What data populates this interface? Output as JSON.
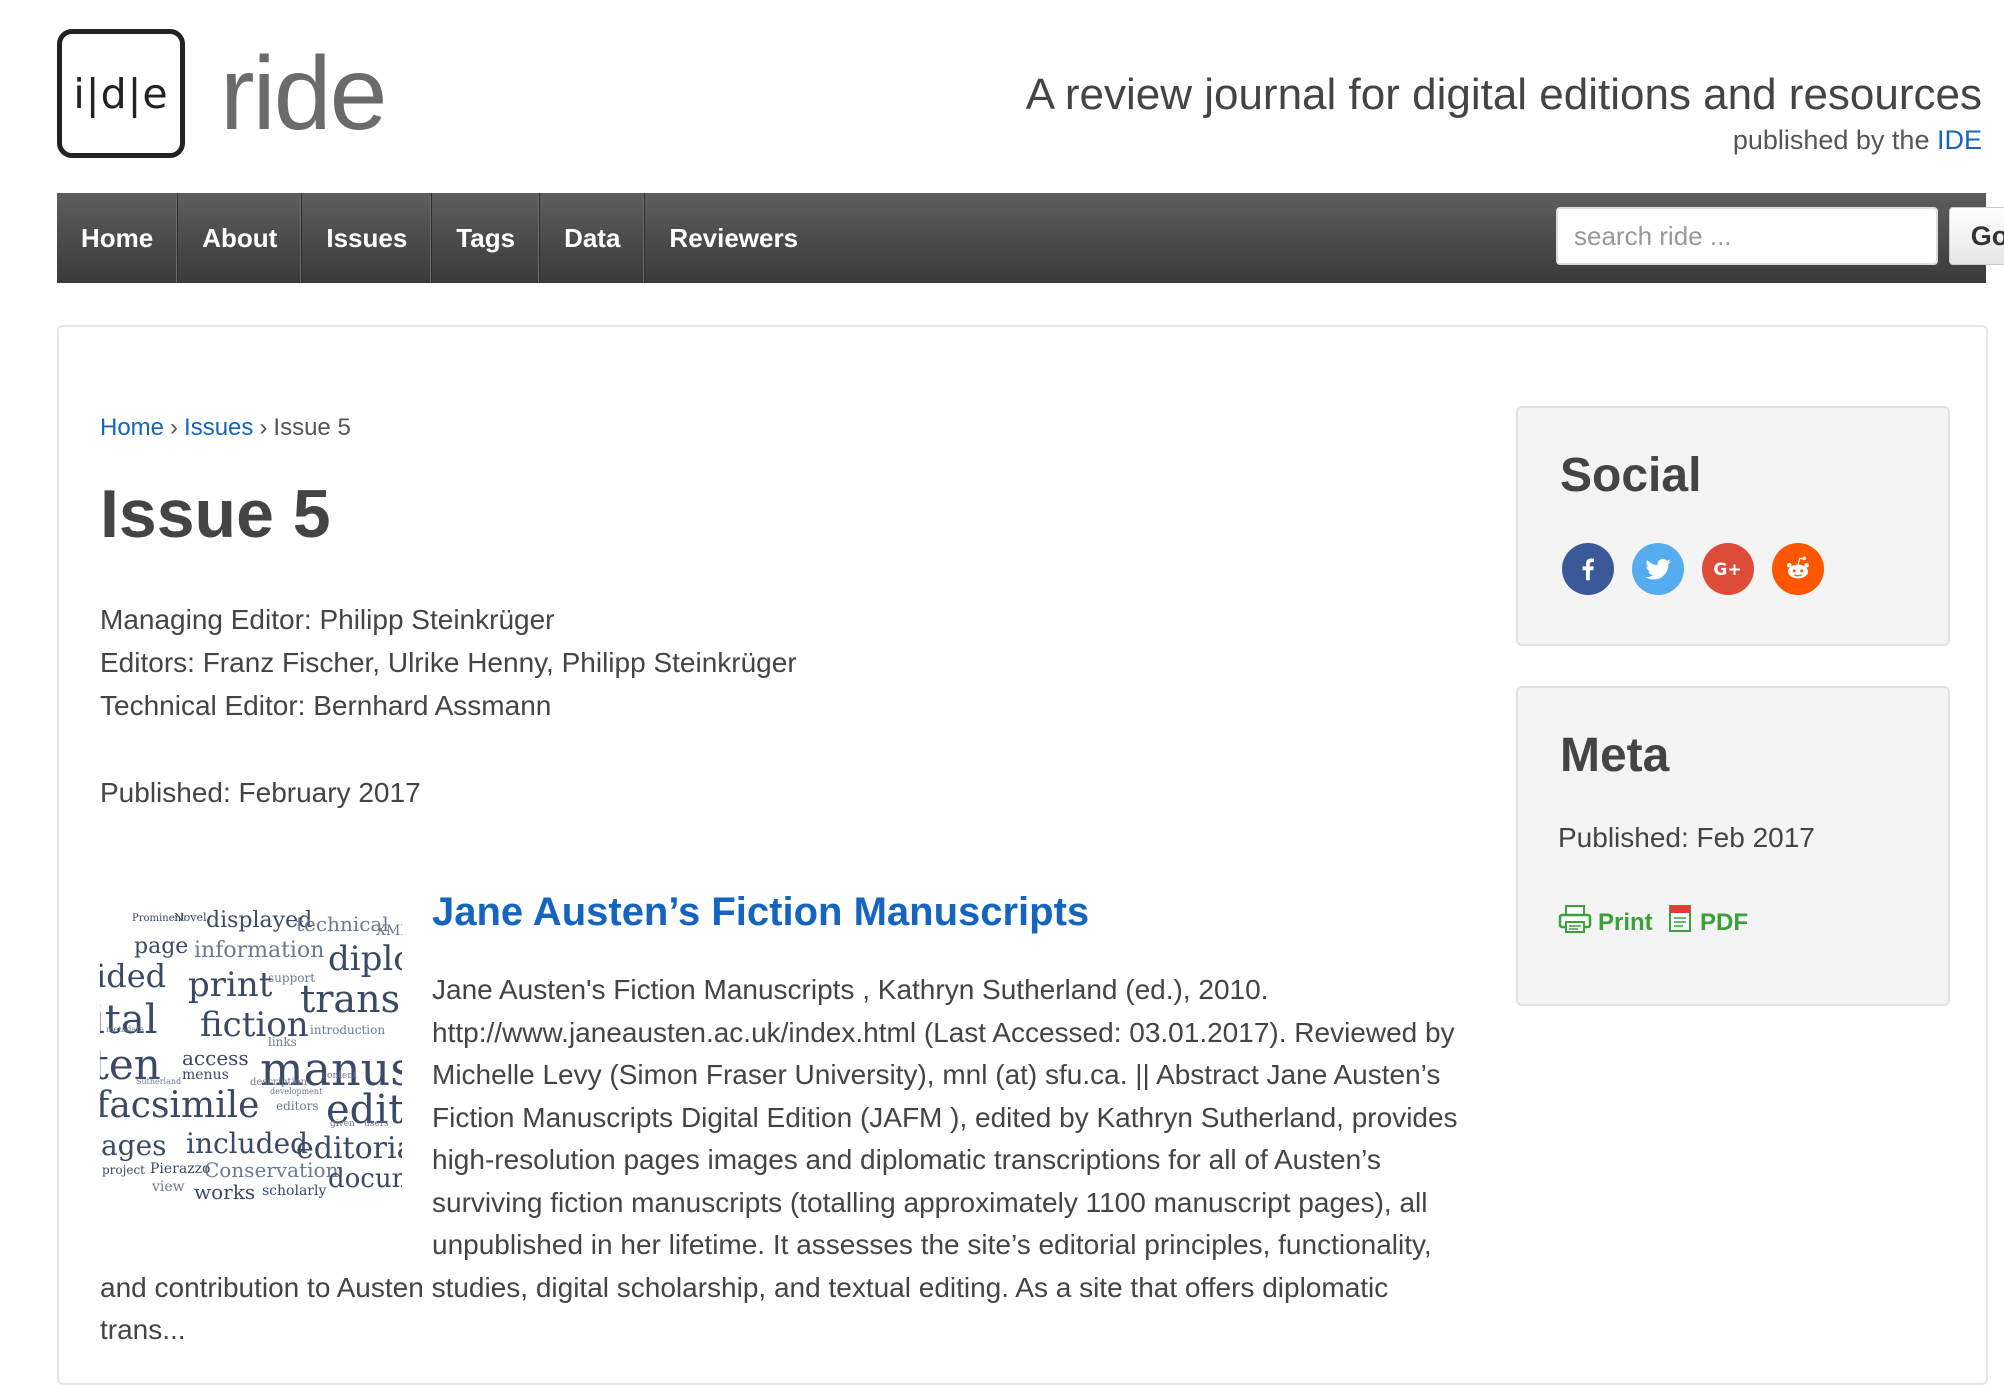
{
  "header": {
    "logo_mark": "i|d|e",
    "logo_word": "ride",
    "tagline": "A review journal for digital editions and resources",
    "publisher_prefix": "published by the",
    "publisher_link": "IDE"
  },
  "nav": {
    "items": [
      "Home",
      "About",
      "Issues",
      "Tags",
      "Data",
      "Reviewers"
    ],
    "search_placeholder": "search ride ...",
    "go_label": "Go"
  },
  "breadcrumb": {
    "home": "Home",
    "sep": "›",
    "issues": "Issues",
    "current": "Issue 5"
  },
  "page": {
    "title": "Issue 5",
    "managing_editor": "Managing Editor: Philipp Steinkrüger",
    "editors": "Editors: Franz Fischer, Ulrike Henny, Philipp Steinkrüger",
    "technical_editor": "Technical Editor: Bernhard Assmann",
    "published": "Published: February 2017"
  },
  "article": {
    "title": "Jane Austen’s Fiction Manuscripts",
    "excerpt": "Jane Austen's Fiction Manuscripts , Kathryn Sutherland (ed.), 2010. http://www.janeausten.ac.uk/index.html (Last Accessed: 03.01.2017). Reviewed by Michelle Levy (Simon Fraser University), mnl (at) sfu.ca. || Abstract Jane Austen’s Fiction Manuscripts Digital Edition (JAFM ), edited by Kathryn Sutherland, provides high-resolution pages images and diplomatic transcriptions for all of Austen’s surviving fiction manuscripts (totalling approximately 1100 manuscript pages), all unpublished in her lifetime. It assesses the site’s editorial principles, functionality, and contribution to Austen studies, digital scholarship, and textual editing. As a site that offers diplomatic trans...",
    "wordcloud": [
      "Prominent",
      "Novel",
      "displayed",
      "technical",
      "XML",
      "page",
      "information",
      "diplo",
      "ided",
      "print",
      "support",
      "transc",
      "ital",
      "fiction",
      "introduction",
      "links",
      "ten",
      "access",
      "menus",
      "manus",
      "facsimile",
      "editors",
      "edit",
      "iages",
      "included",
      "editoria",
      "project",
      "Pierazzo",
      "Conservation",
      "docum",
      "view",
      "works",
      "scholarly",
      "metadata",
      "description",
      "content",
      "development",
      "Sutherland",
      "users",
      "given"
    ]
  },
  "sidebar": {
    "social_title": "Social",
    "social_icons": [
      "facebook-icon",
      "twitter-icon",
      "google-plus-icon",
      "reddit-icon"
    ],
    "meta_title": "Meta",
    "meta_published": "Published: Feb 2017",
    "print_label": "Print",
    "pdf_label": "PDF"
  },
  "colors": {
    "link": "#1565c0",
    "navbar": "#474747",
    "facebook": "#3b5998",
    "twitter": "#55acee",
    "google_plus": "#dd4b39",
    "reddit": "#ff5700",
    "print_green": "#3aa03a"
  }
}
